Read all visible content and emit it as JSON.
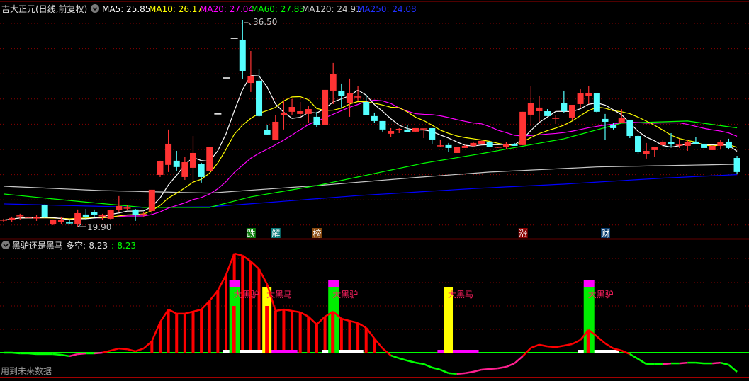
{
  "header": {
    "title": "吉大正元(日线,前复权)",
    "ma": [
      {
        "label": "MA5: 25.85",
        "color": "#ffffff"
      },
      {
        "label": "MA10: 26.17",
        "color": "#ffff00"
      },
      {
        "label": "MA20: 27.04",
        "color": "#ff00ff"
      },
      {
        "label": "MA60: 27.83",
        "color": "#00ff00"
      },
      {
        "label": "MA120: 24.91",
        "color": "#c8c8c8"
      },
      {
        "label": "MA250: 24.08",
        "color": "#0000ff"
      }
    ]
  },
  "price_chart": {
    "high_label": "36.50",
    "low_label": "19.90",
    "up_color": "#ff3333",
    "down_color": "#54ffff",
    "candles_ohlc_note": "open, close, high, low",
    "candles": [
      [
        20.43,
        20.43,
        20.54,
        20.31
      ],
      [
        20.48,
        20.6,
        20.71,
        20.26
      ],
      [
        20.77,
        20.77,
        20.94,
        20.48
      ],
      [
        20.65,
        20.65,
        20.71,
        20.6
      ],
      [
        20.6,
        20.6,
        20.82,
        20.37
      ],
      [
        21.62,
        20.65,
        21.68,
        20.6
      ],
      [
        20.08,
        20.48,
        20.48,
        20.03
      ],
      [
        20.26,
        20.43,
        20.71,
        20.08
      ],
      [
        20.2,
        20.14,
        20.48,
        20.08
      ],
      [
        20.08,
        20.99,
        21.28,
        19.9
      ],
      [
        20.88,
        20.65,
        21.33,
        20.48
      ],
      [
        21.05,
        20.82,
        21.28,
        20.71
      ],
      [
        20.77,
        20.77,
        20.94,
        20.43
      ],
      [
        20.54,
        21.22,
        21.28,
        20.48
      ],
      [
        21.22,
        21.56,
        22.36,
        21.05
      ],
      [
        21.39,
        21.39,
        21.62,
        21.22
      ],
      [
        21.28,
        20.82,
        21.33,
        20.37
      ],
      [
        20.88,
        20.88,
        21.05,
        20.71
      ],
      [
        21.16,
        22.87,
        22.87,
        20.94
      ],
      [
        24.06,
        25.14,
        25.2,
        23.89
      ],
      [
        24.86,
        26.56,
        27.7,
        24.29
      ],
      [
        25.2,
        24.69,
        25.99,
        24.4
      ],
      [
        23.89,
        25.08,
        25.48,
        23.66
      ],
      [
        24.63,
        25.82,
        27.18,
        23.44
      ],
      [
        24.91,
        23.89,
        25.03,
        23.44
      ],
      [
        24.4,
        26.28,
        26.28,
        24.4
      ],
      [
        28.95,
        28.95,
        28.95,
        28.95
      ],
      [
        31.84,
        31.84,
        31.84,
        31.84
      ],
      [
        35.02,
        35.02,
        35.02,
        35.02
      ],
      [
        34.91,
        32.41,
        36.5,
        31.73
      ],
      [
        31.44,
        31.96,
        34.0,
        30.71
      ],
      [
        31.62,
        28.78,
        32.58,
        28.72
      ],
      [
        27.64,
        27.3,
        28.09,
        27.24
      ],
      [
        26.84,
        28.32,
        28.83,
        26.84
      ],
      [
        28.83,
        29.06,
        29.97,
        27.7
      ],
      [
        29.12,
        29.51,
        30.14,
        28.89
      ],
      [
        28.95,
        29.17,
        29.91,
        28.6
      ],
      [
        28.95,
        29.34,
        29.57,
        28.26
      ],
      [
        28.72,
        28.04,
        29.12,
        27.87
      ],
      [
        28.04,
        30.88,
        30.88,
        28.04
      ],
      [
        30.82,
        32.13,
        33.04,
        29.74
      ],
      [
        30.82,
        30.42,
        31.39,
        29.46
      ],
      [
        29.8,
        30.59,
        31.79,
        28.72
      ],
      [
        30.31,
        30.31,
        31.16,
        30.02
      ],
      [
        29.91,
        28.83,
        30.48,
        28.83
      ],
      [
        28.78,
        28.38,
        29.06,
        28.21
      ],
      [
        28.38,
        27.7,
        28.38,
        27.53
      ],
      [
        27.36,
        27.58,
        27.81,
        27.07
      ],
      [
        27.64,
        27.75,
        27.81,
        27.41
      ],
      [
        27.7,
        27.47,
        28.09,
        27.47
      ],
      [
        27.53,
        27.81,
        27.81,
        27.53
      ],
      [
        27.7,
        27.75,
        27.75,
        27.01
      ],
      [
        27.81,
        26.9,
        27.81,
        26.56
      ],
      [
        26.39,
        26.39,
        26.9,
        26.33
      ],
      [
        26.45,
        26.22,
        26.62,
        25.88
      ],
      [
        25.82,
        26.28,
        26.28,
        25.82
      ],
      [
        26.22,
        26.39,
        26.45,
        26.22
      ],
      [
        26.39,
        26.62,
        26.73,
        26.28
      ],
      [
        26.56,
        26.79,
        26.79,
        26.56
      ],
      [
        26.73,
        26.33,
        26.79,
        26.33
      ],
      [
        26.28,
        26.28,
        26.33,
        26.22
      ],
      [
        26.33,
        26.56,
        26.67,
        26.16
      ],
      [
        26.56,
        26.39,
        26.62,
        26.39
      ],
      [
        26.45,
        29.12,
        29.12,
        26.45
      ],
      [
        28.89,
        29.8,
        31.16,
        27.98
      ],
      [
        29.17,
        29.46,
        30.37,
        28.32
      ],
      [
        29.17,
        28.78,
        29.34,
        28.78
      ],
      [
        28.6,
        28.6,
        28.83,
        28.15
      ],
      [
        29.85,
        29.17,
        30.82,
        29.0
      ],
      [
        28.66,
        29.68,
        29.68,
        28.43
      ],
      [
        29.74,
        30.59,
        30.99,
        29.46
      ],
      [
        30.37,
        30.59,
        31.16,
        29.74
      ],
      [
        30.59,
        29.12,
        30.59,
        29.06
      ],
      [
        28.55,
        28.32,
        28.95,
        26.84
      ],
      [
        28.09,
        27.81,
        28.26,
        27.7
      ],
      [
        28.21,
        28.6,
        29.34,
        28.21
      ],
      [
        28.49,
        27.18,
        28.49,
        27.01
      ],
      [
        27.18,
        25.88,
        27.3,
        25.76
      ],
      [
        25.76,
        25.99,
        26.62,
        25.37
      ],
      [
        26.05,
        26.33,
        26.33,
        25.48
      ],
      [
        26.45,
        26.73,
        26.9,
        26.33
      ],
      [
        26.67,
        26.5,
        27.41,
        26.33
      ],
      [
        26.45,
        26.45,
        26.96,
        26.22
      ],
      [
        26.39,
        26.73,
        26.9,
        25.99
      ],
      [
        26.73,
        26.56,
        27.07,
        26.5
      ],
      [
        26.56,
        26.22,
        26.56,
        26.22
      ],
      [
        26.05,
        26.39,
        26.39,
        26.05
      ],
      [
        26.39,
        26.67,
        26.84,
        26.16
      ],
      [
        26.73,
        26.22,
        26.96,
        26.11
      ],
      [
        25.42,
        24.29,
        25.59,
        24.17
      ]
    ],
    "ma_long": {
      "ma60": [
        [
          0,
          22.53
        ],
        [
          8,
          22.0
        ],
        [
          17,
          21.45
        ],
        [
          25,
          21.45
        ],
        [
          30,
          22.3
        ],
        [
          38,
          23.2
        ],
        [
          51,
          25.0
        ],
        [
          58,
          25.77
        ],
        [
          68,
          26.96
        ],
        [
          75,
          28.21
        ],
        [
          83,
          28.38
        ],
        [
          89,
          27.83
        ]
      ],
      "ma120": [
        [
          0,
          23.15
        ],
        [
          12,
          22.8
        ],
        [
          25,
          22.6
        ],
        [
          38,
          23.2
        ],
        [
          50,
          23.85
        ],
        [
          59,
          24.29
        ],
        [
          72,
          24.7
        ],
        [
          89,
          24.91
        ]
      ],
      "ma250": [
        [
          0,
          21.73
        ],
        [
          17,
          21.45
        ],
        [
          25,
          21.5
        ],
        [
          31,
          21.79
        ],
        [
          43,
          22.4
        ],
        [
          58,
          23.0
        ],
        [
          68,
          23.32
        ],
        [
          80,
          23.8
        ],
        [
          89,
          24.08
        ]
      ]
    },
    "markers": [
      {
        "index": 30,
        "text": "跌",
        "bg": "#0a7a0a"
      },
      {
        "index": 33,
        "text": "解",
        "bg": "#0a7a7a"
      },
      {
        "index": 38,
        "text": "榜",
        "bg": "#8a4a10"
      },
      {
        "index": 63,
        "text": "涨",
        "bg": "#8a0000"
      },
      {
        "index": 73,
        "text": "财",
        "bg": "#0a3c6e"
      }
    ]
  },
  "indicator": {
    "name": "黑驴还是黑马",
    "label": "多空:-8.23",
    "value_label": ":-8.23",
    "footer": "用到未来数据",
    "values": [
      0,
      0,
      -0.3,
      -0.3,
      -0.6,
      -0.6,
      -0.6,
      -0.9,
      -1.5,
      -0.6,
      -0.3,
      -0.3,
      0,
      0.9,
      1.8,
      1.5,
      0.6,
      1.8,
      4.9,
      13.1,
      18.6,
      16.8,
      16.8,
      17.7,
      18.6,
      22.3,
      26.8,
      33.5,
      42.7,
      41.8,
      39.3,
      36.0,
      29.3,
      18.0,
      18.6,
      18.0,
      17.4,
      15.5,
      12.2,
      15.5,
      17.7,
      14.6,
      13.7,
      12.8,
      10.7,
      6.1,
      1.8,
      -1.2,
      -2.4,
      -3.4,
      -4.3,
      -4.9,
      -6.4,
      -7.3,
      -8.8,
      -9.1,
      -8.8,
      -8.2,
      -7.3,
      -7.0,
      -6.7,
      -6.1,
      -4.6,
      -1.5,
      2.1,
      3.4,
      2.7,
      2.4,
      3.0,
      3.7,
      5.5,
      9.8,
      7.0,
      4.0,
      1.8,
      0.9,
      -0.6,
      -2.7,
      -4.9,
      -4.9,
      -4.9,
      -4.6,
      -4.6,
      -4.3,
      -4.3,
      -4.6,
      -4.6,
      -4.3,
      -5.2,
      -8.23
    ],
    "signals": [
      {
        "index": 28,
        "type": "donkey",
        "text": "大黑驴"
      },
      {
        "index": 32,
        "type": "horse",
        "text": "大黑马"
      },
      {
        "index": 40,
        "type": "donkey",
        "text": "大黑驴"
      },
      {
        "index": 54,
        "type": "horse",
        "text": "大黑马"
      },
      {
        "index": 71,
        "type": "donkey",
        "text": "大黑驴"
      }
    ],
    "base_bands": [
      {
        "from": 27,
        "to": 32,
        "color": "#ffffff"
      },
      {
        "from": 32,
        "to": 36,
        "color": "#ff00ff"
      },
      {
        "from": 39,
        "to": 44,
        "color": "#ffffff"
      },
      {
        "from": 53,
        "to": 58,
        "color": "#ff00ff"
      },
      {
        "from": 70,
        "to": 75,
        "color": "#ffffff"
      }
    ]
  }
}
